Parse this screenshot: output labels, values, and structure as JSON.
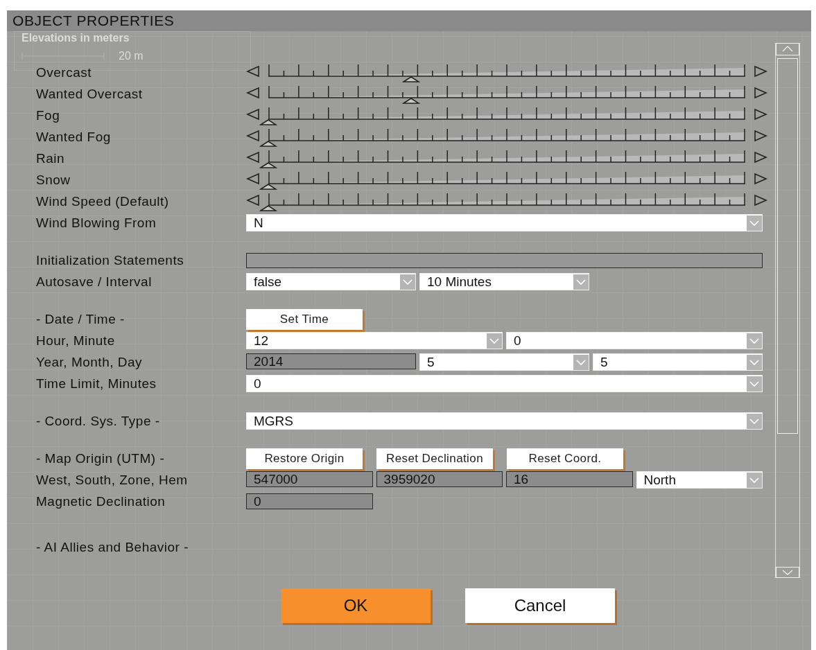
{
  "window": {
    "title": "OBJECT PROPERTIES"
  },
  "background_legend": {
    "title": "Elevations in meters",
    "scale_label": "20 m"
  },
  "sections": [
    {
      "rows": [
        {
          "kind": "slider",
          "label": "Overcast",
          "level": 0.3
        },
        {
          "kind": "slider",
          "label": "Wanted Overcast",
          "level": 0.3
        },
        {
          "kind": "slider",
          "label": "Fog",
          "level": 0
        },
        {
          "kind": "slider",
          "label": "Wanted Fog",
          "level": 0
        },
        {
          "kind": "slider",
          "label": "Rain",
          "level": 0
        },
        {
          "kind": "slider",
          "label": "Snow",
          "level": 0
        },
        {
          "kind": "slider",
          "label": "Wind Speed (Default)",
          "level": 0
        },
        {
          "kind": "controls",
          "label": "Wind Blowing From",
          "items": [
            {
              "kind": "dropdown",
              "value": "N"
            }
          ]
        }
      ]
    },
    {
      "rows": [
        {
          "kind": "controls",
          "label": "Initialization Statements",
          "items": [
            {
              "kind": "text_field"
            }
          ]
        },
        {
          "kind": "controls",
          "label": "Autosave / Interval",
          "items": [
            {
              "kind": "dropdown",
              "value": "false"
            },
            {
              "kind": "dropdown",
              "value": "10 Minutes"
            }
          ]
        }
      ]
    },
    {
      "rows": [
        {
          "kind": "controls",
          "label": "- Date / Time -",
          "items": [
            {
              "kind": "button",
              "value": "Set Time"
            }
          ]
        },
        {
          "kind": "controls",
          "label": "Hour, Minute",
          "items": [
            {
              "kind": "dropdown",
              "value": "12"
            },
            {
              "kind": "dropdown",
              "value": "0"
            }
          ]
        },
        {
          "kind": "controls",
          "label": "Year, Month, Day",
          "items": [
            {
              "kind": "readonly",
              "value": "2014"
            },
            {
              "kind": "dropdown",
              "value": "5"
            },
            {
              "kind": "dropdown",
              "value": "5"
            }
          ]
        },
        {
          "kind": "controls",
          "label": "Time Limit, Minutes",
          "items": [
            {
              "kind": "dropdown",
              "value": "0"
            }
          ]
        }
      ]
    },
    {
      "rows": [
        {
          "kind": "controls",
          "label": "- Coord. Sys. Type -",
          "items": [
            {
              "kind": "dropdown",
              "value": "MGRS"
            }
          ]
        }
      ]
    },
    {
      "rows": [
        {
          "kind": "controls",
          "label": "- Map Origin (UTM) -",
          "items": [
            {
              "kind": "button",
              "value": "Restore Origin"
            },
            {
              "kind": "button",
              "value": "Reset Declination"
            },
            {
              "kind": "button",
              "value": "Reset Coord."
            }
          ]
        },
        {
          "kind": "controls",
          "label": "West, South, Zone, Hem",
          "items": [
            {
              "kind": "readonly",
              "value": "547000"
            },
            {
              "kind": "readonly",
              "value": "3959020"
            },
            {
              "kind": "readonly",
              "value": "16"
            },
            {
              "kind": "dropdown",
              "value": "North"
            }
          ]
        },
        {
          "kind": "controls",
          "label": "Magnetic Declination",
          "items": [
            {
              "kind": "readonly",
              "value": "0"
            }
          ]
        }
      ]
    },
    {
      "rows": [
        {
          "kind": "heading",
          "label": "- AI Allies and Behavior -"
        }
      ]
    }
  ],
  "buttons": [
    {
      "kind": "primary",
      "label": "OK"
    },
    {
      "kind": "secondary",
      "label": "Cancel"
    }
  ]
}
